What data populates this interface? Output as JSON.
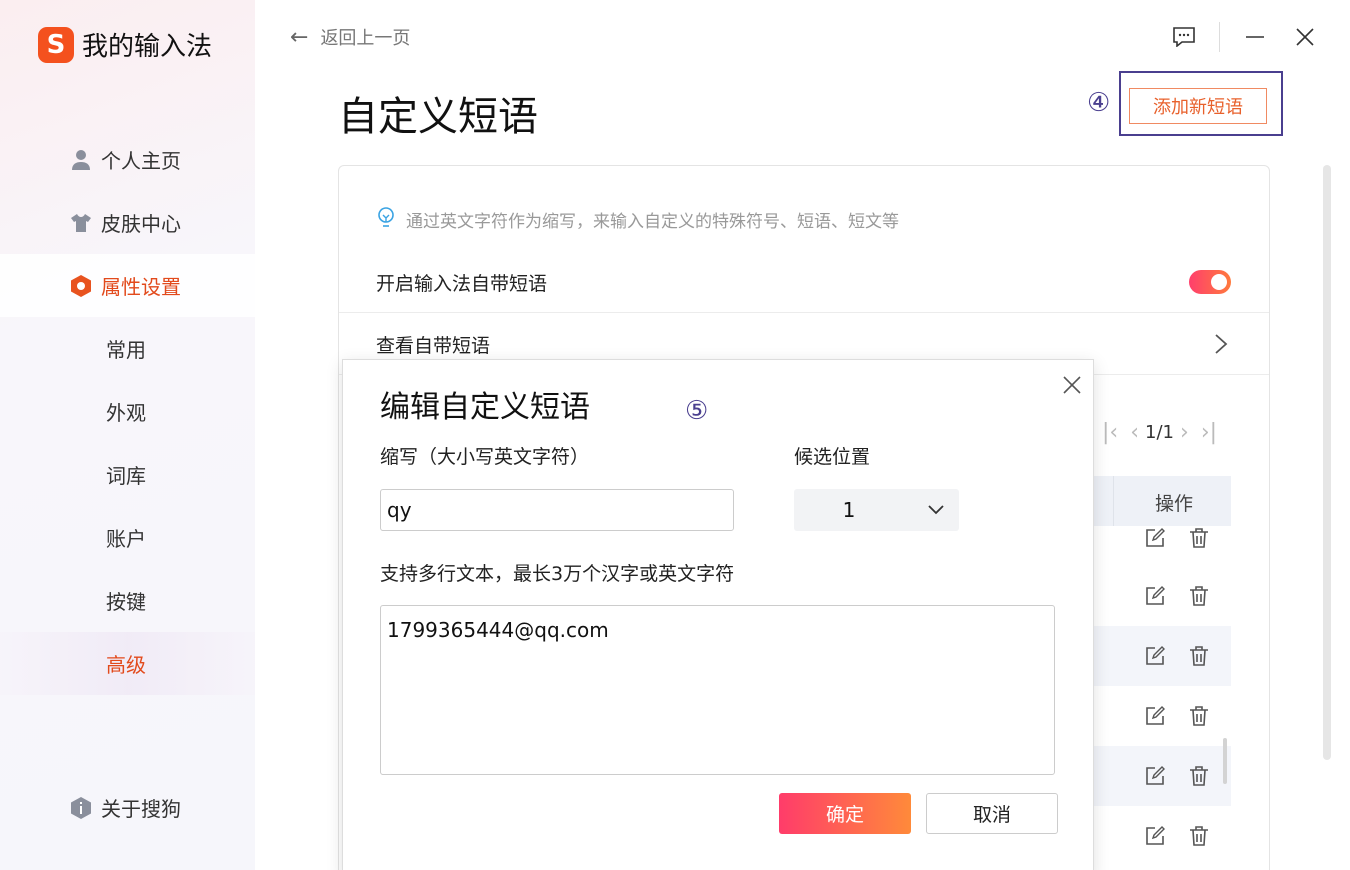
{
  "app": {
    "name": "我的输入法",
    "logo_letter": "S"
  },
  "sidebar": {
    "items": [
      {
        "label": "个人主页",
        "icon": "user-icon"
      },
      {
        "label": "皮肤中心",
        "icon": "shirt-icon"
      },
      {
        "label": "属性设置",
        "icon": "settings-hex-icon"
      }
    ],
    "sub_items": [
      "常用",
      "外观",
      "词库",
      "账户",
      "按键",
      "高级"
    ],
    "active_sub": "高级",
    "about": {
      "label": "关于搜狗",
      "icon": "info-icon"
    }
  },
  "header": {
    "back_label": "返回上一页",
    "title": "自定义短语",
    "add_button": "添加新短语",
    "step4_marker": "④"
  },
  "settings": {
    "hint": "通过英文字符作为缩写，来输入自定义的特殊符号、短语、短文等",
    "toggle_label": "开启输入法自带短语",
    "toggle_on": true,
    "view_label": "查看自带短语"
  },
  "table": {
    "pager": "1/1",
    "op_header": "操作",
    "row_count": 6
  },
  "dialog": {
    "title": "编辑自定义短语",
    "step5_marker": "⑤",
    "abbr_label": "缩写（大小写英文字符）",
    "abbr_value": "qy",
    "position_label": "候选位置",
    "position_value": "1",
    "content_label": "支持多行文本，最长3万个汉字或英文字符",
    "content_value": "1799365444@qq.com",
    "ok": "确定",
    "cancel": "取消"
  },
  "colors": {
    "accent": "#e24a1c",
    "marker": "#4a3f8f",
    "toggle_start": "#ff3f6c",
    "toggle_end": "#ff7a3d"
  }
}
